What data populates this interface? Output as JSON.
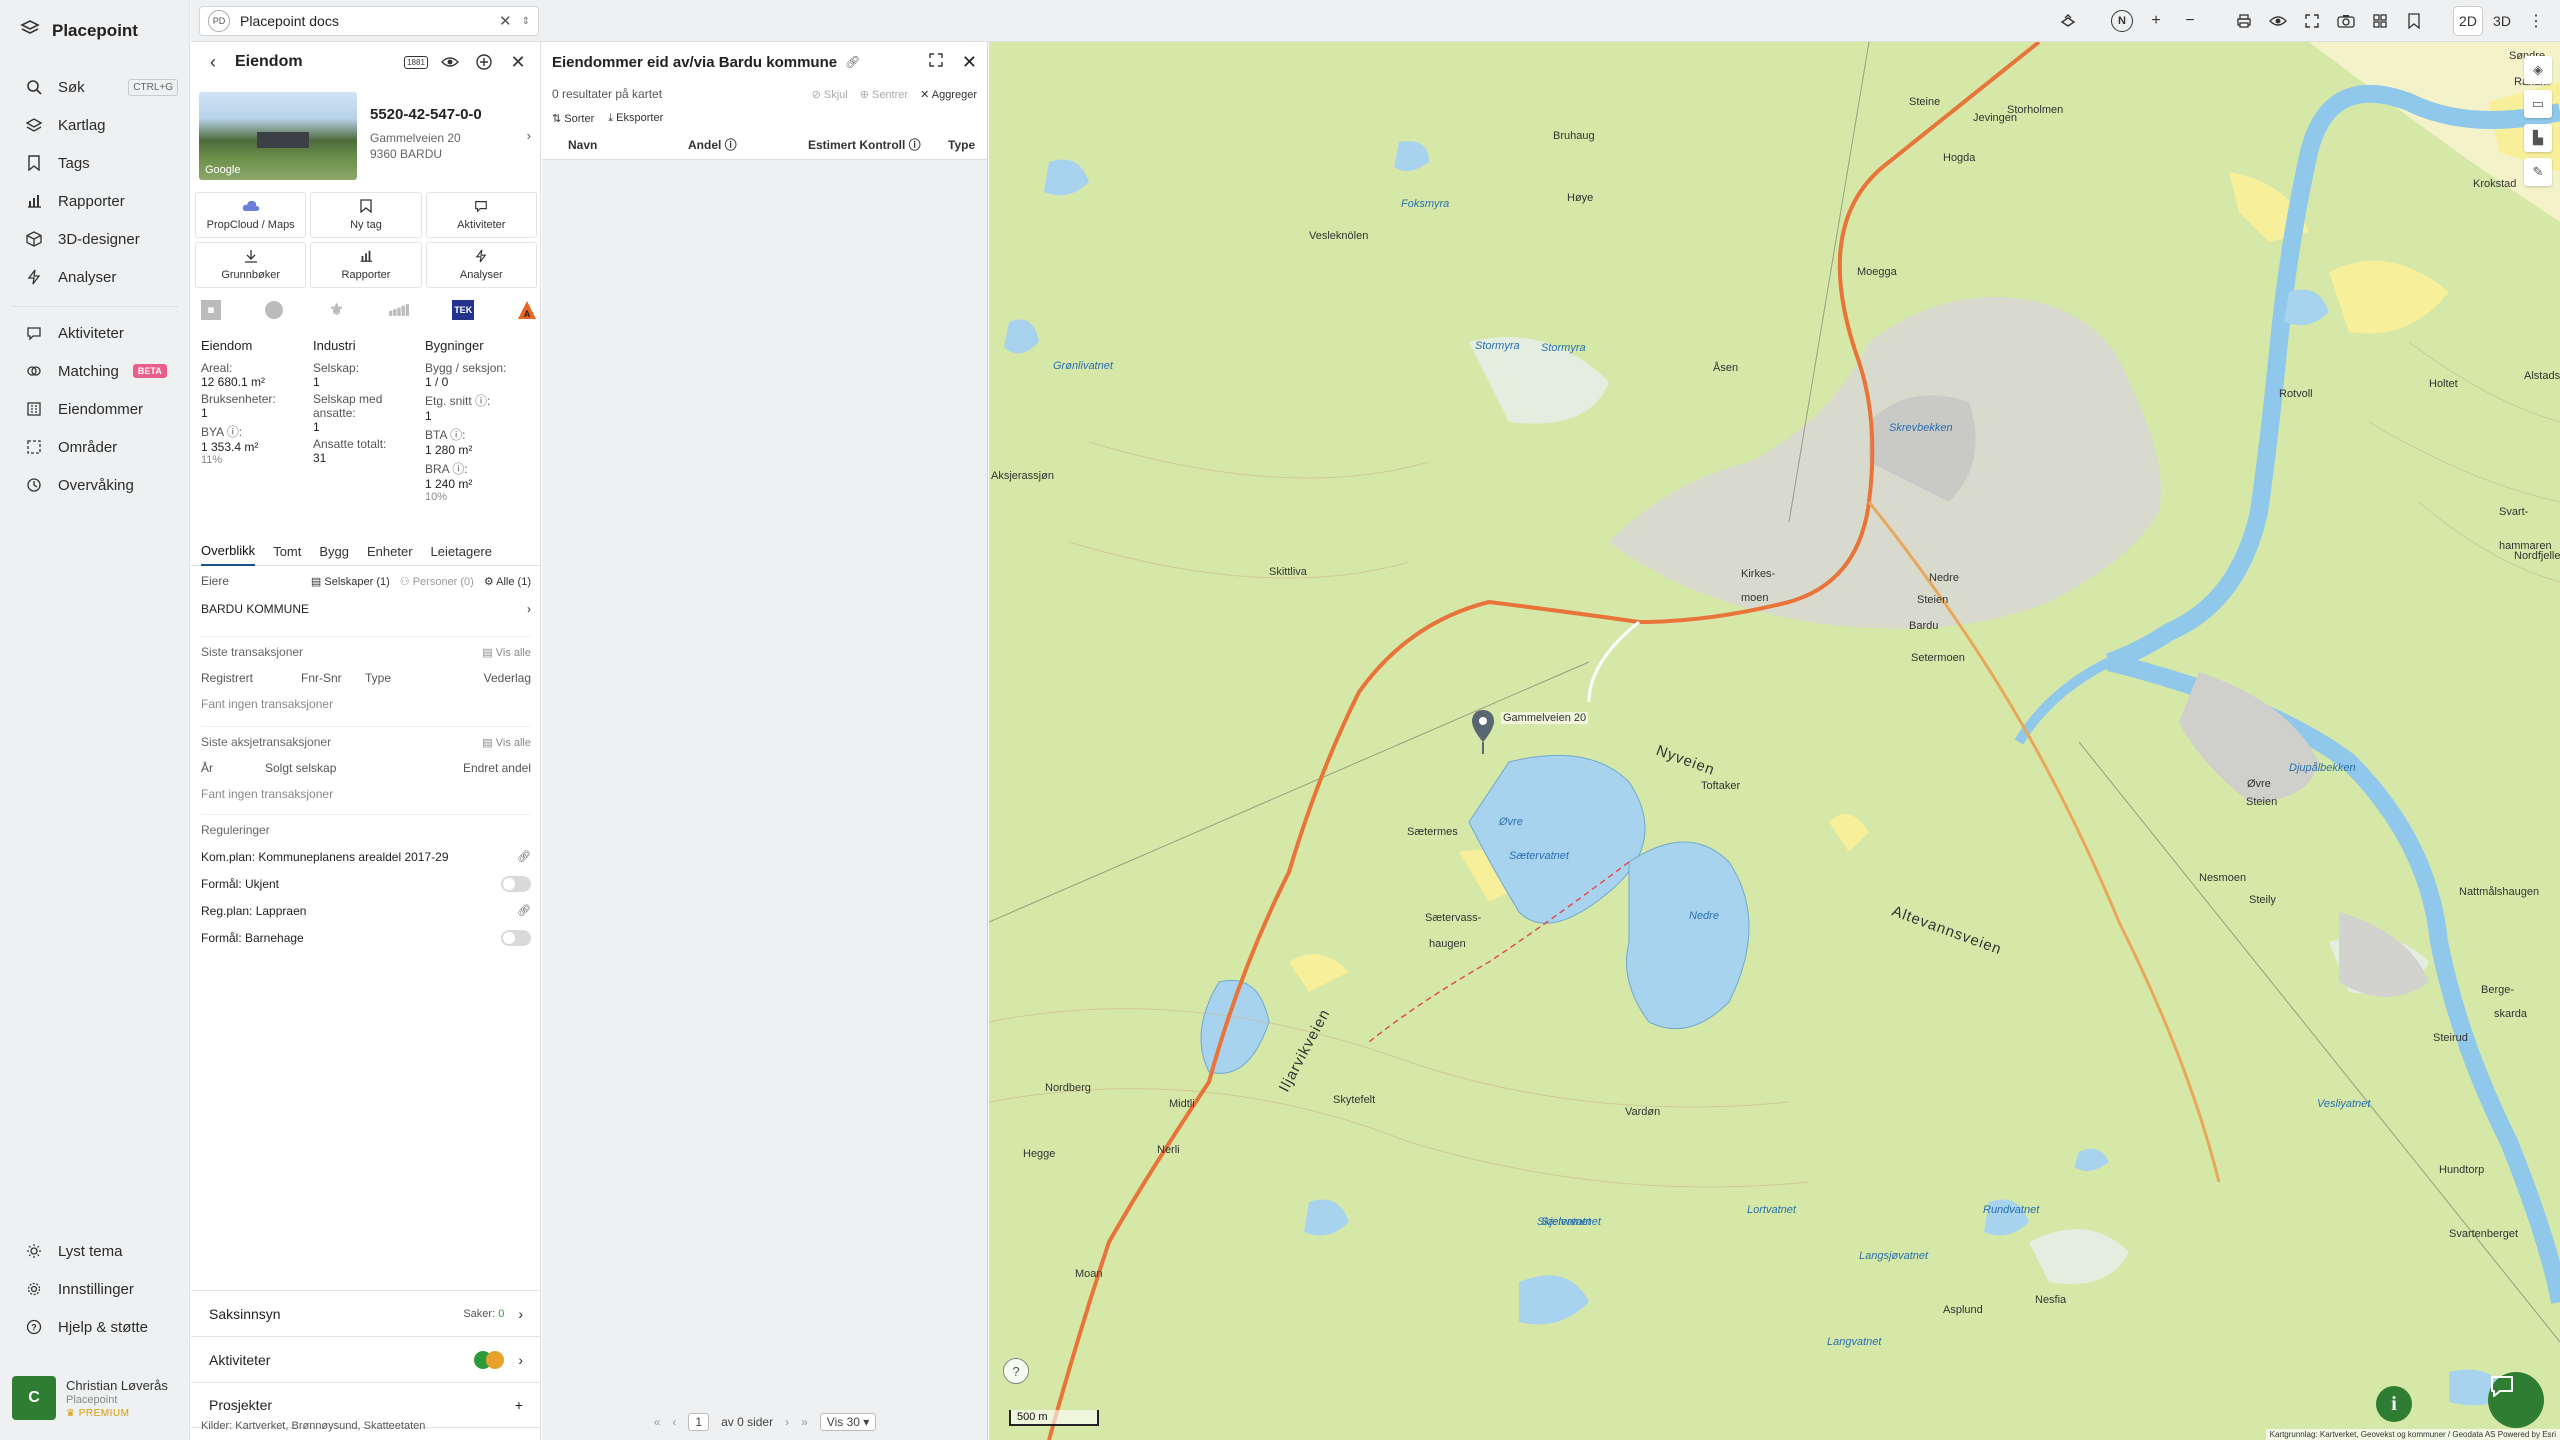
{
  "app": {
    "name": "Placepoint"
  },
  "sidebar": {
    "search": {
      "label": "Søk",
      "shortcut": "CTRL+G"
    },
    "items_top": [
      {
        "label": "Kartlag",
        "icon": "layers-icon"
      },
      {
        "label": "Tags",
        "icon": "bookmark-icon"
      },
      {
        "label": "Rapporter",
        "icon": "chart-icon"
      },
      {
        "label": "3D-designer",
        "icon": "cube-icon"
      },
      {
        "label": "Analyser",
        "icon": "bolt-icon"
      }
    ],
    "items_mid": [
      {
        "label": "Aktiviteter",
        "icon": "chat-icon"
      },
      {
        "label": "Matching",
        "icon": "matching-icon",
        "badge": "BETA"
      },
      {
        "label": "Eiendommer",
        "icon": "building-icon"
      },
      {
        "label": "Områder",
        "icon": "area-icon"
      },
      {
        "label": "Overvåking",
        "icon": "monitor-icon"
      }
    ],
    "items_bottom": [
      {
        "label": "Lyst tema",
        "icon": "sun-icon"
      },
      {
        "label": "Innstillinger",
        "icon": "gear-icon"
      },
      {
        "label": "Hjelp & støtte",
        "icon": "help-icon"
      }
    ],
    "user": {
      "initial": "C",
      "name": "Christian Løverås",
      "org": "Placepoint",
      "plan": "PREMIUM"
    }
  },
  "topbar": {
    "doc_badge": "PD",
    "doc_title": "Placepoint docs",
    "view_2d": "2D",
    "view_3d": "3D",
    "north": "N"
  },
  "property": {
    "header_title": "Eiendom",
    "header_badge": "1881",
    "photo_credit": "Google",
    "id": "5520-42-547-0-0",
    "address1": "Gammelveien 20",
    "address2": "9360 BARDU",
    "actions": [
      {
        "label": "PropCloud / Maps",
        "icon": "cloud-icon"
      },
      {
        "label": "Ny tag",
        "icon": "bookmark-icon"
      },
      {
        "label": "Aktiviteter",
        "icon": "chat-icon"
      },
      {
        "label": "Grunnbøker",
        "icon": "download-icon"
      },
      {
        "label": "Rapporter",
        "icon": "chart-icon"
      },
      {
        "label": "Analyser",
        "icon": "bolt-icon"
      }
    ],
    "logo_tek": "TEK",
    "stats": {
      "col1_title": "Eiendom",
      "areal_label": "Areal:",
      "areal_value": "12 680.1 m²",
      "bruks_label": "Bruksenheter:",
      "bruks_value": "1",
      "bya_label": "BYA ⓘ:",
      "bya_value": "1 353.4 m²",
      "bya_pct": "11%",
      "col2_title": "Industri",
      "selskap_label": "Selskap:",
      "selskap_value": "1",
      "ansatte_label": "Selskap med ansatte:",
      "ansatte_value": "1",
      "ansatte_tot_label": "Ansatte totalt:",
      "ansatte_tot_value": "31",
      "col3_title": "Bygninger",
      "bygg_label": "Bygg / seksjon:",
      "bygg_value": "1 / 0",
      "etg_label": "Etg. snitt ⓘ:",
      "etg_value": "1",
      "bta_label": "BTA ⓘ:",
      "bta_value": "1 280 m²",
      "bra_label": "BRA ⓘ:",
      "bra_value": "1 240 m²",
      "bra_pct": "10%"
    },
    "tabs": [
      "Overblikk",
      "Tomt",
      "Bygg",
      "Enheter",
      "Leietagere"
    ],
    "owners": {
      "title": "Eiere",
      "f_selskaper": "Selskaper (1)",
      "f_personer": "Personer (0)",
      "f_alle": "Alle (1)",
      "owner": "BARDU KOMMUNE"
    },
    "transactions": {
      "title": "Siste transaksjoner",
      "vis_alle": "Vis alle",
      "cols": [
        "Registrert",
        "Fnr-Snr",
        "Type",
        "Vederlag"
      ],
      "empty": "Fant ingen transaksjoner"
    },
    "share_tx": {
      "title": "Siste aksjetransaksjoner",
      "vis_alle": "Vis alle",
      "cols": [
        "År",
        "Solgt selskap",
        "Endret andel"
      ],
      "empty": "Fant ingen transaksjoner"
    },
    "regulations": {
      "title": "Reguleringer",
      "items": [
        {
          "label": "Kom.plan: Kommuneplanens arealdel 2017-29",
          "type": "link"
        },
        {
          "label": "Formål: Ukjent",
          "type": "toggle"
        },
        {
          "label": "Reg.plan: Lappraen",
          "type": "link"
        },
        {
          "label": "Formål: Barnehage",
          "type": "toggle"
        }
      ]
    },
    "accordion": {
      "saksinnsyn": "Saksinnsyn",
      "saker_label": "Saker:",
      "saker_value": "0",
      "aktiviteter": "Aktiviteter",
      "prosjekter": "Prosjekter"
    },
    "sources": "Kilder: Kartverket, Brønnøysund, Skatteetaten"
  },
  "results": {
    "title": "Eiendommer eid av/via Bardu kommune",
    "count_text": "0 resultater på kartet",
    "opt_skjul": "Skjul",
    "opt_sentrer": "Sentrer",
    "opt_aggreger": "Aggreger",
    "tool_sorter": "Sorter",
    "tool_eksporter": "Eksporter",
    "columns": [
      "Navn",
      "Andel ⓘ",
      "Estimert Kontroll ⓘ",
      "Type"
    ],
    "pager": {
      "page": "1",
      "of_text": "av 0 sider",
      "per_page": "Vis 30"
    }
  },
  "map": {
    "scale": "500 m",
    "attribution": "Kartgrunnlag: Kartverket, Geovekst og kommuner / Geodata AS Powered by Esri",
    "marker_label": "Gammelveien 20",
    "colors": {
      "forest": "#d4e6a4",
      "water": "#a8d3ef",
      "road": "#e8743a",
      "settlement": "#c9c9c9"
    },
    "labels": [
      {
        "text": "Søndre",
        "kind": "place"
      },
      {
        "text": "Ranum",
        "kind": "place"
      },
      {
        "text": "Steine",
        "kind": "place"
      },
      {
        "text": "Jevingen",
        "kind": "place"
      },
      {
        "text": "Storholmen",
        "kind": "place"
      },
      {
        "text": "Hogda",
        "kind": "place"
      },
      {
        "text": "Bruhaug",
        "kind": "place"
      },
      {
        "text": "Høye",
        "kind": "place"
      },
      {
        "text": "Foksmyra",
        "kind": "water"
      },
      {
        "text": "Vesleknölen",
        "kind": "place"
      },
      {
        "text": "Moegga",
        "kind": "place"
      },
      {
        "text": "Krokstad",
        "kind": "place"
      },
      {
        "text": "Åsen",
        "kind": "place"
      },
      {
        "text": "Stormyra",
        "kind": "water"
      },
      {
        "text": "Grønlivatnet",
        "kind": "water"
      },
      {
        "text": "Rotvoll",
        "kind": "place"
      },
      {
        "text": "Holtet",
        "kind": "place"
      },
      {
        "text": "Alstadsætra",
        "kind": "place"
      },
      {
        "text": "Svart-",
        "kind": "place"
      },
      {
        "text": "hammaren",
        "kind": "place"
      },
      {
        "text": "Nordfjellet",
        "kind": "place"
      },
      {
        "text": "Skittliva",
        "kind": "place"
      },
      {
        "text": "Kirkes-",
        "kind": "place"
      },
      {
        "text": "moen",
        "kind": "place"
      },
      {
        "text": "Nedre",
        "kind": "place"
      },
      {
        "text": "Steien",
        "kind": "place"
      },
      {
        "text": "Bardu",
        "kind": "place"
      },
      {
        "text": "Setermoen",
        "kind": "place"
      },
      {
        "text": "Nyveien",
        "kind": "road"
      },
      {
        "text": "Altevannsveien",
        "kind": "road"
      },
      {
        "text": "Toftaker",
        "kind": "place"
      },
      {
        "text": "Sætermes",
        "kind": "place"
      },
      {
        "text": "Øvre",
        "kind": "water"
      },
      {
        "text": "Sætervatnet",
        "kind": "water"
      },
      {
        "text": "Nedre",
        "kind": "water"
      },
      {
        "text": "Skytefelt",
        "kind": "place"
      },
      {
        "text": "Sætervass-",
        "kind": "place"
      },
      {
        "text": "haugen",
        "kind": "place"
      },
      {
        "text": "Øvre",
        "kind": "place"
      },
      {
        "text": "Steien",
        "kind": "place"
      },
      {
        "text": "Nesmoen",
        "kind": "place"
      },
      {
        "text": "Steily",
        "kind": "place"
      },
      {
        "text": "Nattmålshaugen",
        "kind": "place"
      },
      {
        "text": "Berge-",
        "kind": "place"
      },
      {
        "text": "skarda",
        "kind": "place"
      },
      {
        "text": "Nordberg",
        "kind": "place"
      },
      {
        "text": "Midtli",
        "kind": "place"
      },
      {
        "text": "Nerli",
        "kind": "place"
      },
      {
        "text": "Hegge",
        "kind": "place"
      },
      {
        "text": "Moan",
        "kind": "place"
      },
      {
        "text": "Iljarvikveien",
        "kind": "road"
      },
      {
        "text": "Vardøn",
        "kind": "place"
      },
      {
        "text": "Rundvatnet",
        "kind": "water"
      },
      {
        "text": "Steirud",
        "kind": "place"
      },
      {
        "text": "Hundtorp",
        "kind": "place"
      },
      {
        "text": "Svartenberget",
        "kind": "place"
      },
      {
        "text": "Asplund",
        "kind": "place"
      },
      {
        "text": "Nesfia",
        "kind": "place"
      },
      {
        "text": "Langvatnet",
        "kind": "water"
      },
      {
        "text": "Langsjøvatnet",
        "kind": "water"
      },
      {
        "text": "Skjelvatnet",
        "kind": "water"
      },
      {
        "text": "Lortvatnet",
        "kind": "water"
      },
      {
        "text": "Vesliyatnet",
        "kind": "water"
      },
      {
        "text": "Sætervatnet",
        "kind": "water"
      },
      {
        "text": "Stormyra",
        "kind": "water"
      },
      {
        "text": "Skrevbekken",
        "kind": "water"
      },
      {
        "text": "Djupålbekken",
        "kind": "water"
      },
      {
        "text": "Gammelveien 20",
        "kind": "marker"
      },
      {
        "text": "Aksjerassjøn",
        "kind": "place"
      }
    ]
  }
}
